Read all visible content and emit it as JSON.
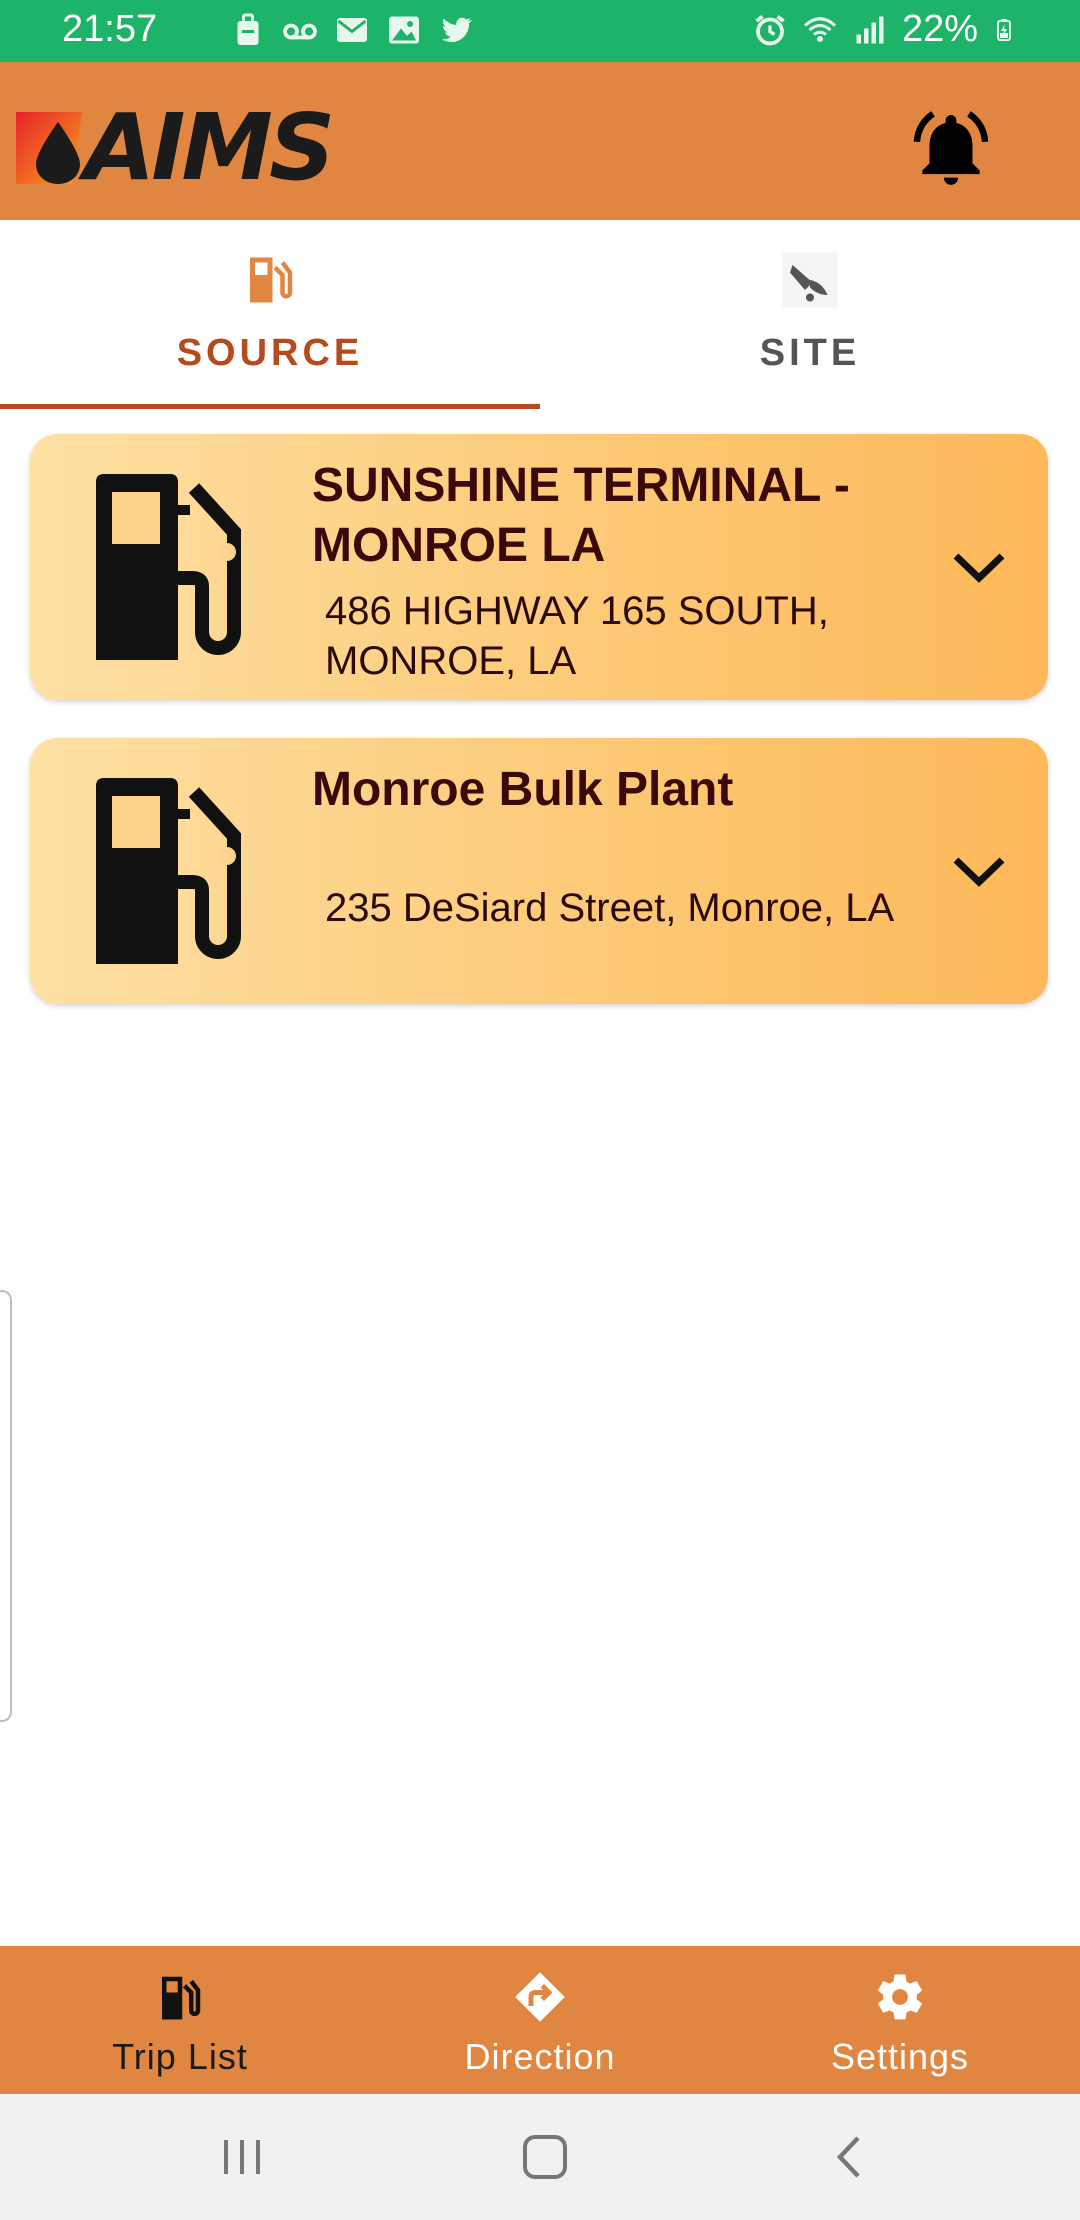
{
  "status_bar": {
    "time": "21:57",
    "battery": "22%",
    "left_icons": [
      "shopping-bag-icon",
      "voicemail-icon",
      "mail-icon",
      "image-icon",
      "twitter-icon"
    ],
    "right_icons": [
      "alarm-icon",
      "wifi-icon",
      "signal-icon",
      "battery-charging-icon"
    ]
  },
  "header": {
    "logo_text": "AIMS",
    "notification_icon": "bell-icon"
  },
  "tabs": [
    {
      "label": "SOURCE",
      "icon": "fuel-pump-icon",
      "selected": true
    },
    {
      "label": "SITE",
      "icon": "fuel-nozzle-icon",
      "selected": false
    }
  ],
  "cards": [
    {
      "title": "SUNSHINE TERMINAL - MONROE LA",
      "address": "486 HIGHWAY 165 SOUTH, MONROE, LA",
      "icon": "fuel-pump-icon"
    },
    {
      "title": "Monroe Bulk Plant",
      "address": "235 DeSiard Street, Monroe, LA",
      "icon": "fuel-pump-icon"
    }
  ],
  "bottom_nav": [
    {
      "label": "Trip List",
      "icon": "fuel-pump-icon",
      "active": true
    },
    {
      "label": "Direction",
      "icon": "direction-icon",
      "active": false
    },
    {
      "label": "Settings",
      "icon": "gear-icon",
      "active": false
    }
  ],
  "colors": {
    "status_bar": "#1db46a",
    "primary": "#e08641",
    "tab_active": "#b54a1c",
    "card_gradient_start": "#fde0a3",
    "card_gradient_end": "#fdb85a"
  }
}
